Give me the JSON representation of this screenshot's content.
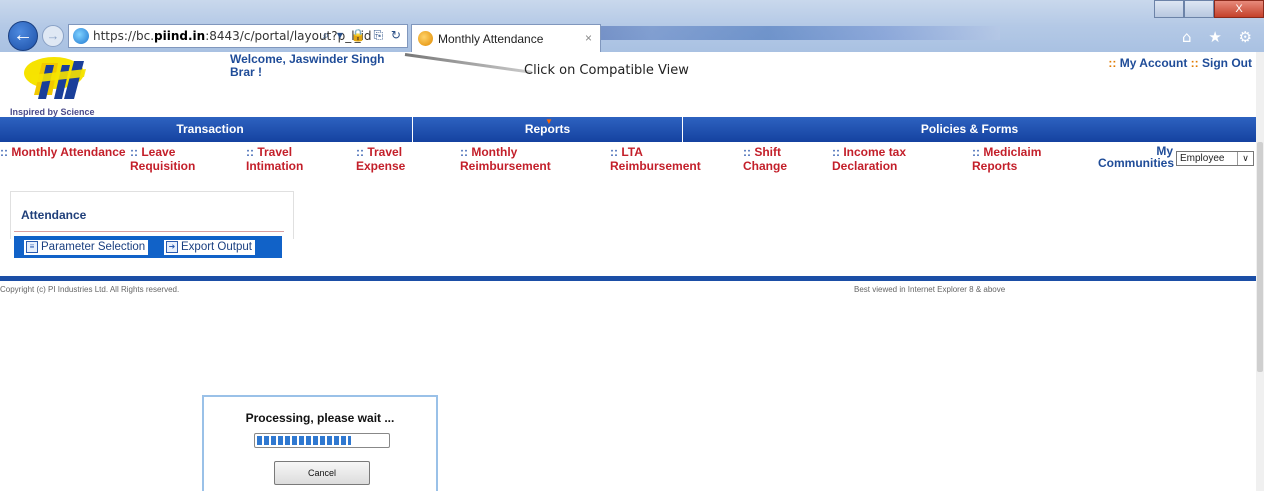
{
  "browser": {
    "url_prefix": "https://bc.",
    "url_domain": "piind.in",
    "url_rest": ":8443/c/portal/layout?p_l_id",
    "address_icons": "⌕ ▾ 🔒 ⎘ ↻",
    "tab_title": "Monthly Attendance",
    "tab_close": "×",
    "window_close": "X",
    "toolbar_icons": "⌂ ★ ⚙"
  },
  "header": {
    "tagline": "Inspired by Science",
    "welcome": "Welcome, Jaswinder Singh Brar !",
    "annotation": "Click on Compatible View",
    "account_sep1": "::",
    "my_account": "My Account",
    "account_sep2": "::",
    "sign_out": "Sign Out"
  },
  "navbar": {
    "sections": [
      "Transaction",
      "Reports",
      "Policies & Forms"
    ],
    "active_marker": "▼"
  },
  "submenu": {
    "bullet": "::",
    "items": [
      "Monthly Attendance",
      "Leave Requisition",
      "Travel Intimation",
      "Travel Expense",
      "Monthly Reimbursement",
      "LTA Reimbursement",
      "Shift Change",
      "Income tax Declaration",
      "Mediclaim Reports"
    ],
    "my_communities": "My Communities",
    "community_select": "Employee",
    "select_arrow": "∨"
  },
  "attendance": {
    "title": "Attendance",
    "parameter_selection": "Parameter Selection",
    "export_output": "Export Output"
  },
  "footer": {
    "copyright": "Copyright (c) PI Industries Ltd. All Rights reserved.",
    "best_viewed": "Best viewed in Internet Explorer 8 & above"
  },
  "processing": {
    "message": "Processing, please wait ...",
    "progress": 0.72,
    "cancel_label": "Cancel"
  },
  "colors": {
    "nav_blue": "#1542a0",
    "menu_red": "#c31f2a",
    "link_blue": "#1f4c98",
    "accent_orange": "#e07a00"
  }
}
